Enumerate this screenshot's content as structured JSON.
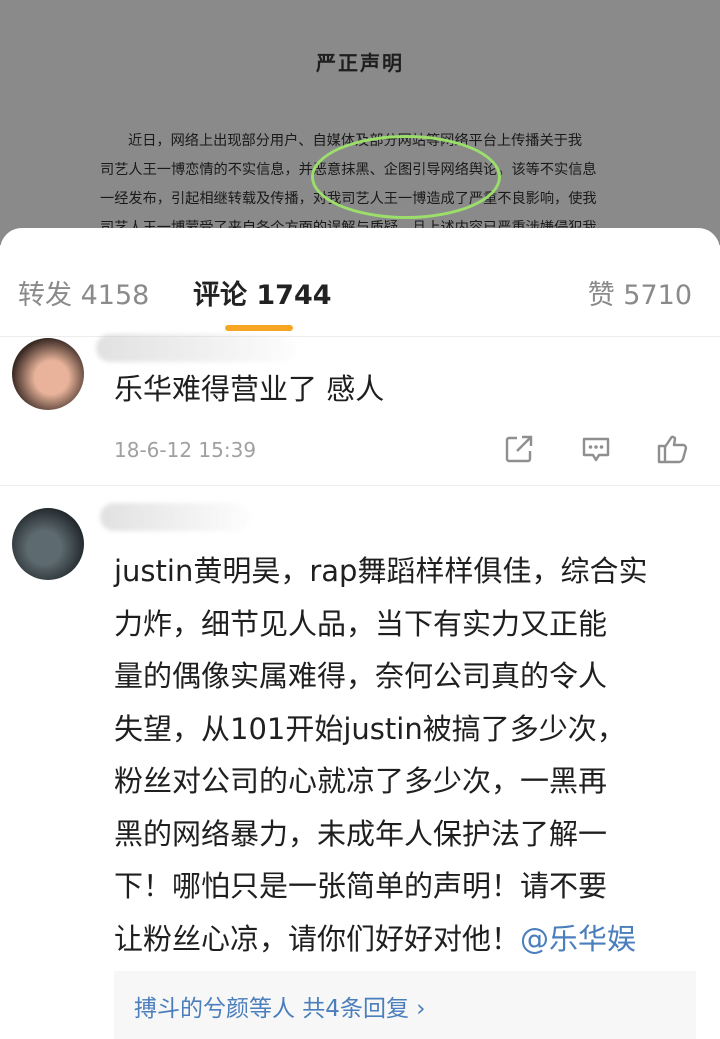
{
  "document": {
    "title": "严正声明",
    "lines": [
      "近日，网络上出现部分用户、自媒体及部分网站等网络平台上传播关于我",
      "司艺人王一博恋情的不实信息，并恶意抹黑、企图引导网络舆论。该等不实信息",
      "一经发布，引起相继转载及传播，对我司艺人王一博造成了严重不良影响，使我",
      "司艺人王一博蒙受了来自各个方面的误解与质疑。且上述内容已严重涉嫌侵犯我"
    ]
  },
  "tabs": {
    "repost": "转发 4158",
    "comments": "评论 1744",
    "likes": "赞 5710"
  },
  "comments": [
    {
      "avatar": "user-avatar",
      "text": "乐华难得营业了 感人",
      "time": "18-6-12 15:39",
      "actions": [
        "share-icon",
        "reply-icon",
        "like-icon"
      ]
    },
    {
      "avatar": "user-avatar",
      "lines": [
        "justin黄明昊，rap舞蹈样样俱佳，综合实",
        "力炸，细节见人品，当下有实力又正能",
        "量的偶像实属难得，奈何公司真的令人",
        "失望，从101开始justin被搞了多少次，",
        "粉丝对公司的心就凉了多少次，一黑再",
        "黑的网络暴力，未成年人保护法了解一",
        "下！哪怕只是一张简单的声明！请不要",
        "让粉丝心凉，请你们好好对他！"
      ],
      "mention_a": "@乐华娱",
      "mention_b": "乐",
      "replies": "搏斗的兮颜等人  共4条回复 ›"
    }
  ],
  "colors": {
    "accent": "#f7a623",
    "link": "#4a7ebc",
    "highlight_circle": "#9bde6a"
  }
}
